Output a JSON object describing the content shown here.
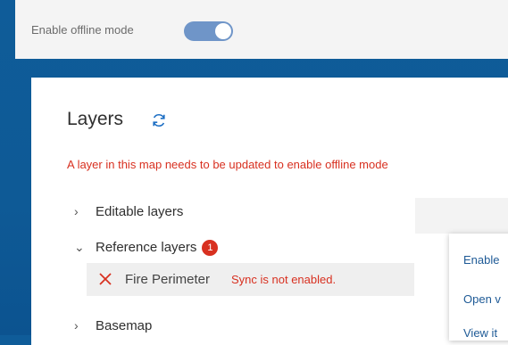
{
  "topbar": {
    "offline_label": "Enable offline mode",
    "offline_toggle_on": true
  },
  "panel": {
    "title": "Layers",
    "warning": "A layer in this map needs to be updated to enable offline mode",
    "groups": [
      {
        "label": "Editable layers",
        "expanded": false
      },
      {
        "label": "Reference layers",
        "expanded": true,
        "badge": "1"
      },
      {
        "label": "Basemap",
        "expanded": false
      }
    ],
    "fire_layer": {
      "name": "Fire Perimeter",
      "status": "Sync is not enabled."
    }
  },
  "context_menu": {
    "items": [
      "Enable",
      "Open v",
      "View it"
    ]
  },
  "colors": {
    "background": "#0f5c99",
    "error": "#d83020",
    "toggle": "#6f95c8",
    "link": "#1e5a96"
  },
  "icons": [
    "refresh-icon",
    "chevron-right-icon",
    "chevron-down-icon",
    "close-icon"
  ]
}
